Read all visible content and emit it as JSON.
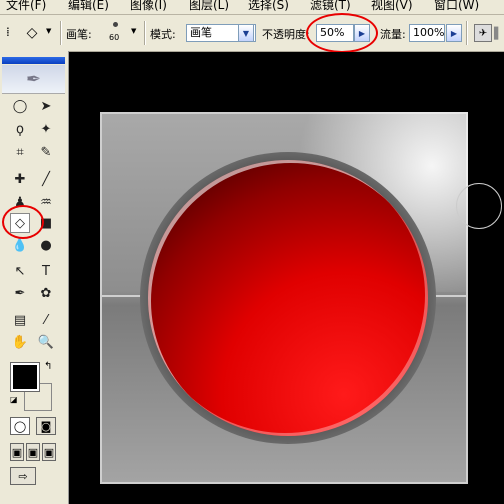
{
  "menubar": {
    "items": [
      "文件(F)",
      "编辑(E)",
      "图像(I)",
      "图层(L)",
      "选择(S)",
      "滤镜(T)",
      "视图(V)",
      "窗口(W)"
    ]
  },
  "options": {
    "brush_label": "画笔:",
    "brush_size": "60",
    "mode_label": "模式:",
    "mode_value": "画笔",
    "opacity_label": "不透明度:",
    "opacity_value": "50%",
    "flow_label": "流量:",
    "flow_value": "100%"
  },
  "colors": {
    "foreground": "#000000",
    "background": "#ffffff",
    "highlight": "#e80000",
    "accent_red": "#e00000"
  },
  "icons": [
    "eraser-icon",
    "marquee-icon",
    "move-icon",
    "lasso-icon",
    "magic-wand-icon",
    "crop-icon",
    "slice-icon",
    "healing-icon",
    "brush-icon",
    "stamp-icon",
    "history-brush-icon",
    "eraser-tool-icon",
    "gradient-icon",
    "blur-icon",
    "dodge-icon",
    "path-select-icon",
    "type-icon",
    "pen-icon",
    "shape-icon",
    "notes-icon",
    "eyedropper-icon",
    "hand-icon",
    "zoom-icon"
  ]
}
